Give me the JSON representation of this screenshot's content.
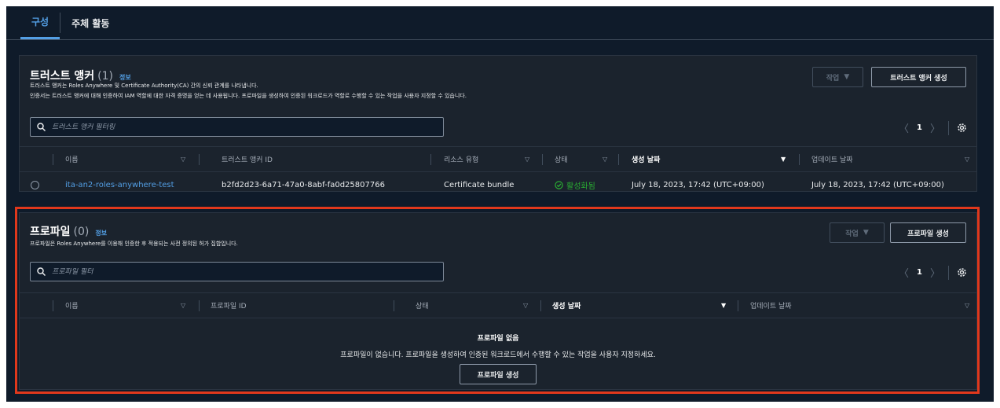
{
  "tabs": [
    {
      "label": "구성",
      "active": true
    },
    {
      "label": "주체 활동",
      "active": false
    }
  ],
  "trust_anchors": {
    "title": "트러스트 앵커",
    "count": "(1)",
    "info": "정보",
    "description_1": "트러스트 앵커는 Roles Anywhere 및 Certificate Authority(CA) 간의 신뢰 관계를 나타냅니다.",
    "description_2": "인증서는 트러스트 앵커에 대해 인증하여 IAM 역할에 대한 자격 증명을 얻는 데 사용됩니다. 프로파일을 생성하여 인증된 워크로드가 역할로 수행할 수 있는 작업을 사용자 지정할 수 있습니다.",
    "actions_label": "작업",
    "create_label": "트러스트 앵커 생성",
    "search_placeholder": "트러스트 앵커 필터링",
    "page": "1",
    "columns": [
      "이름",
      "트러스트 앵커 ID",
      "리소스 유형",
      "상태",
      "생성 날짜",
      "업데이트 날짜"
    ],
    "rows": [
      {
        "name": "ita-an2-roles-anywhere-test",
        "id": "b2fd2d23-6a71-47a0-8abf-fa0d25807766",
        "resource_type": "Certificate bundle",
        "status": "활성화됨",
        "created": "July 18, 2023, 17:42 (UTC+09:00)",
        "updated": "July 18, 2023, 17:42 (UTC+09:00)"
      }
    ]
  },
  "profiles": {
    "title": "프로파일",
    "count": "(0)",
    "info": "정보",
    "description": "프로파일은 Roles Anywhere를 이용해 인증한 후 적용되는 사전 정의된 허가 집합입니다.",
    "actions_label": "작업",
    "create_label": "프로파일 생성",
    "search_placeholder": "프로파일 필터",
    "page": "1",
    "columns": [
      "이름",
      "프로파일 ID",
      "상태",
      "생성 날짜",
      "업데이트 날짜"
    ],
    "empty_title": "프로파일 없음",
    "empty_desc": "프로파일이 없습니다. 프로파일을 생성하여 인증된 워크로드에서 수행할 수 있는 작업을 사용자 지정하세요.",
    "empty_button": "프로파일 생성"
  },
  "colors": {
    "background": "#0f1b2a",
    "panel": "#1b232d",
    "link": "#539fe5",
    "success": "#29ad32",
    "highlight": "#e0381c"
  }
}
